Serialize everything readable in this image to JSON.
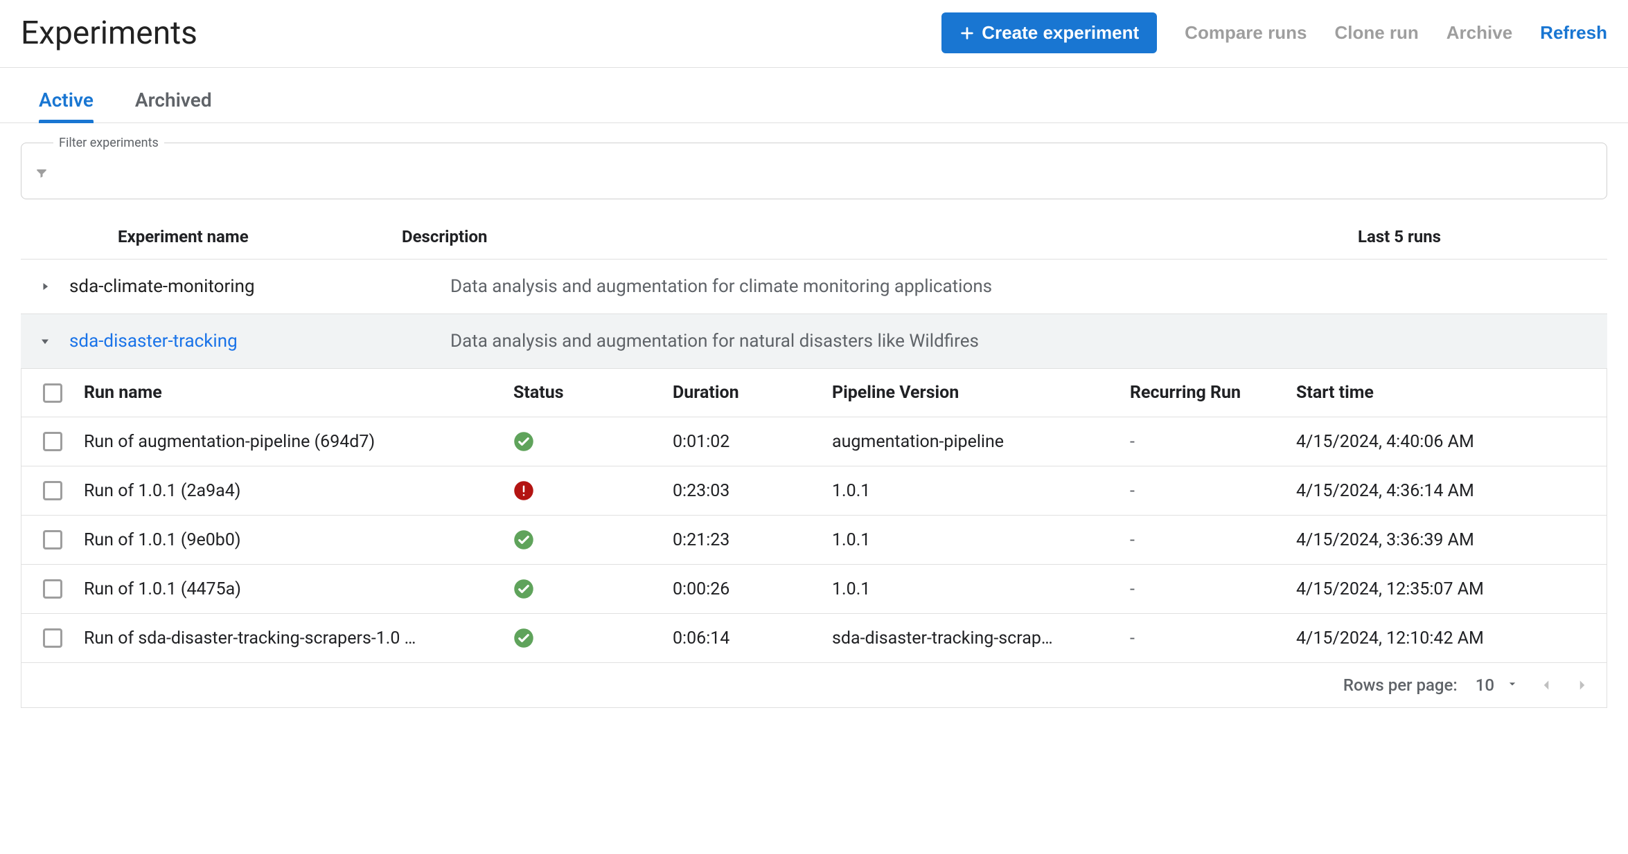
{
  "page_title": "Experiments",
  "header_actions": {
    "create_label": "Create experiment",
    "compare_label": "Compare runs",
    "clone_label": "Clone run",
    "archive_label": "Archive",
    "refresh_label": "Refresh"
  },
  "tabs": {
    "active_label": "Active",
    "archived_label": "Archived"
  },
  "filter": {
    "legend": "Filter experiments",
    "value": ""
  },
  "exp_columns": {
    "name": "Experiment name",
    "desc": "Description",
    "last5": "Last 5 runs"
  },
  "experiments": [
    {
      "name": "sda-climate-monitoring",
      "description": "Data analysis and augmentation for climate monitoring applications",
      "expanded": false
    },
    {
      "name": "sda-disaster-tracking",
      "description": "Data analysis and augmentation for natural disasters like Wildfires",
      "expanded": true
    }
  ],
  "run_columns": {
    "name": "Run name",
    "status": "Status",
    "duration": "Duration",
    "pipeline": "Pipeline Version",
    "recurring": "Recurring Run",
    "start": "Start time"
  },
  "runs": [
    {
      "name": "Run of augmentation-pipeline (694d7)",
      "status": "success",
      "duration": "0:01:02",
      "pipeline": "augmentation-pipeline",
      "recurring": "-",
      "start": "4/15/2024, 4:40:06 AM"
    },
    {
      "name": "Run of 1.0.1 (2a9a4)",
      "status": "error",
      "duration": "0:23:03",
      "pipeline": "1.0.1",
      "recurring": "-",
      "start": "4/15/2024, 4:36:14 AM"
    },
    {
      "name": "Run of 1.0.1 (9e0b0)",
      "status": "success",
      "duration": "0:21:23",
      "pipeline": "1.0.1",
      "recurring": "-",
      "start": "4/15/2024, 3:36:39 AM"
    },
    {
      "name": "Run of 1.0.1 (4475a)",
      "status": "success",
      "duration": "0:00:26",
      "pipeline": "1.0.1",
      "recurring": "-",
      "start": "4/15/2024, 12:35:07 AM"
    },
    {
      "name": "Run of sda-disaster-tracking-scrapers-1.0 …",
      "status": "success",
      "duration": "0:06:14",
      "pipeline": "sda-disaster-tracking-scrap…",
      "recurring": "-",
      "start": "4/15/2024, 12:10:42 AM"
    }
  ],
  "pagination": {
    "rows_label": "Rows per page:",
    "rows_value": "10"
  }
}
